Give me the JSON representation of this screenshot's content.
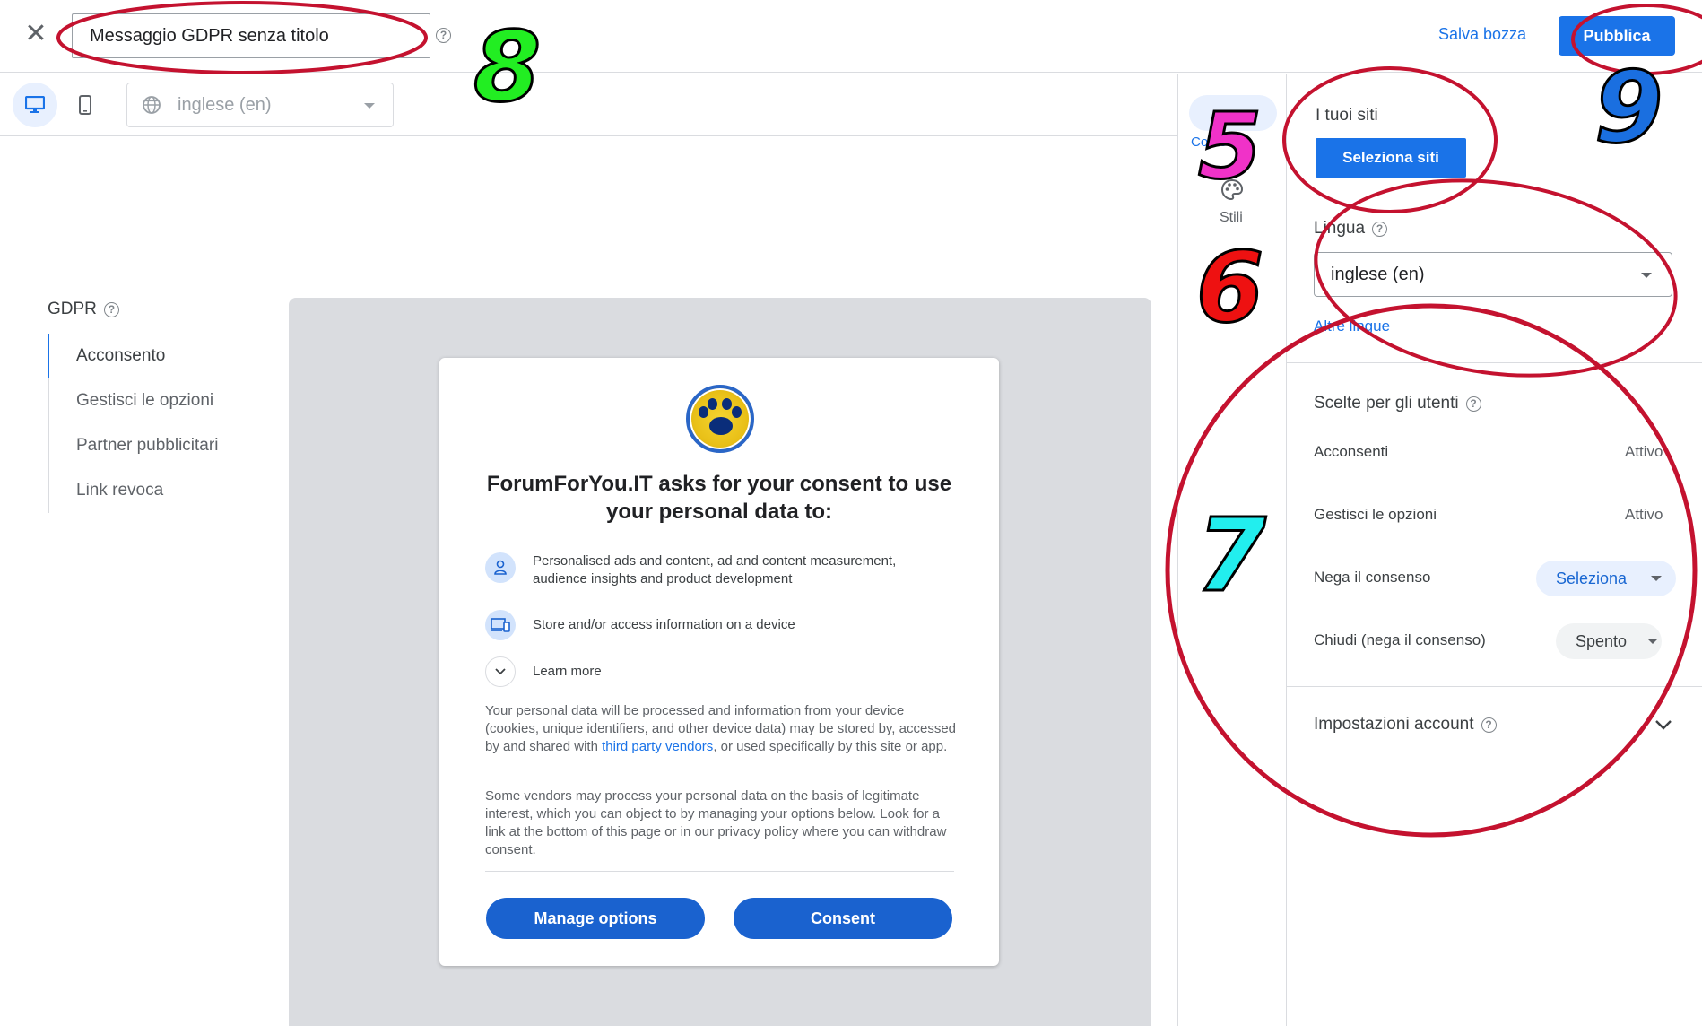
{
  "header": {
    "title_value": "Messaggio GDPR senza titolo",
    "save_draft_label": "Salva bozza",
    "publish_label": "Pubblica"
  },
  "toolbar": {
    "language_value": "inglese (en)"
  },
  "left_nav": {
    "heading": "GDPR",
    "items": [
      {
        "label": "Acconsento"
      },
      {
        "label": "Gestisci le opzioni"
      },
      {
        "label": "Partner pubblicitari"
      },
      {
        "label": "Link revoca"
      }
    ]
  },
  "consent_card": {
    "title": "ForumForYou.IT asks for your consent to use your personal data to:",
    "purposes": [
      {
        "text": "Personalised ads and content, ad and content measurement, audience insights and product development"
      },
      {
        "text": "Store and/or access information on a device"
      }
    ],
    "learn_more": "Learn more",
    "para1_before": "Your personal data will be processed and information from your device (cookies, unique identifiers, and other device data) may be stored by, accessed by and shared with ",
    "para1_link": "third party vendors",
    "para1_after": ", or used specifically by this site or app.",
    "para2": "Some vendors may process your personal data on the basis of legitimate interest, which you can object to by managing your options below. Look for a link at the bottom of this page or in our privacy policy where you can withdraw consent.",
    "manage_options_label": "Manage options",
    "consent_label": "Consent"
  },
  "icon_column": {
    "tab_label": "Contenuto",
    "styles_label": "Stili"
  },
  "right_panel": {
    "sites_label": "I tuoi siti",
    "select_sites_label": "Seleziona siti",
    "language_label": "Lingua",
    "language_value": "inglese (en)",
    "more_languages_label": "Altre lingue",
    "user_choices_label": "Scelte per gli utenti",
    "choices": [
      {
        "label": "Acconsenti",
        "value": "Attivo"
      },
      {
        "label": "Gestisci le opzioni",
        "value": "Attivo"
      },
      {
        "label": "Nega il consenso",
        "value": "Seleziona"
      },
      {
        "label": "Chiudi (nega il consenso)",
        "value": "Spento"
      }
    ],
    "account_settings_label": "Impostazioni account"
  },
  "annotations": {
    "labels": [
      "8",
      "9",
      "5",
      "6",
      "7"
    ],
    "colors": {
      "8": "#22ee22",
      "9": "#1a6fe0",
      "5": "#f032c8",
      "6": "#ee1111",
      "7": "#22eeee",
      "ellipse": "#c4122f"
    }
  },
  "colors": {
    "accent": "#1a73e8",
    "preview_bg": "#dadce0",
    "consent_button": "#1a62cf"
  }
}
